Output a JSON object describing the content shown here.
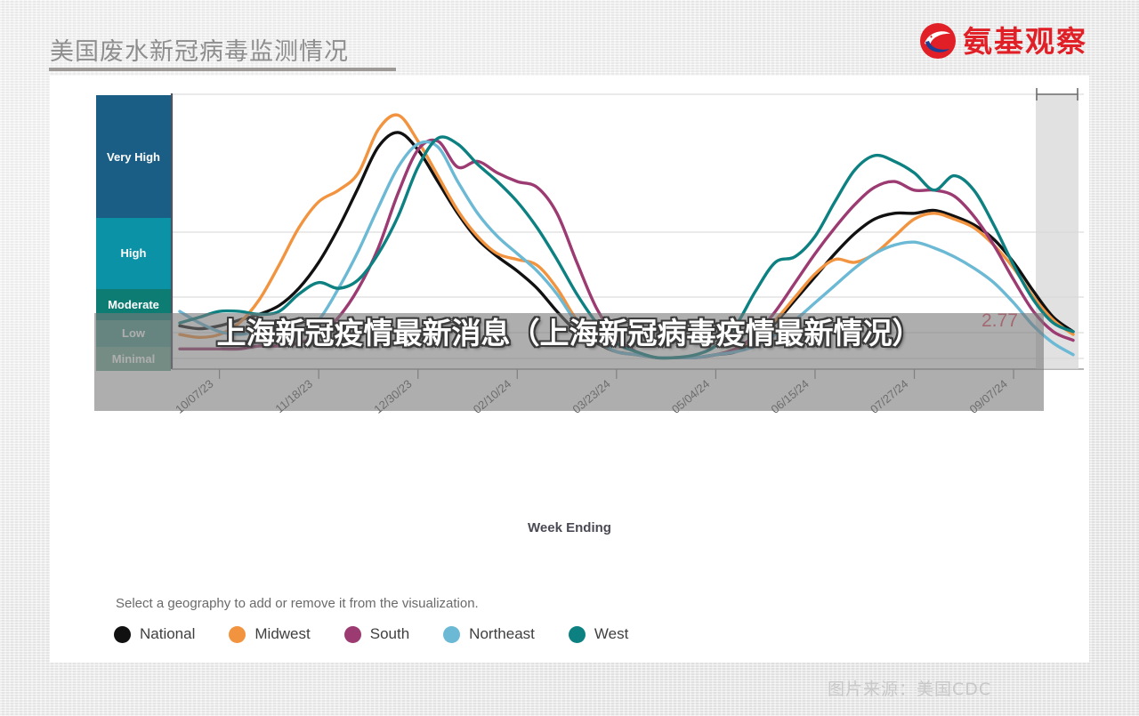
{
  "header": {
    "title": "美国废水新冠病毒监测情况",
    "brand_name": "氨基观察",
    "brand_mark": "circular-swoosh-logo"
  },
  "overlay": {
    "text": "上海新冠疫情最新消息（上海新冠病毒疫情最新情况）"
  },
  "source": {
    "text": "图片来源：美国CDC"
  },
  "legend": {
    "hint": "Select a geography to add or remove it from the visualization.",
    "items": [
      {
        "label": "National",
        "color": "#111111"
      },
      {
        "label": "Midwest",
        "color": "#f2943f"
      },
      {
        "label": "South",
        "color": "#9c3a72"
      },
      {
        "label": "Northeast",
        "color": "#6bb9d4"
      },
      {
        "label": "West",
        "color": "#0d8082"
      }
    ]
  },
  "chart_data": {
    "type": "line",
    "title": "",
    "xlabel": "Week Ending",
    "ylabel": "",
    "grid": true,
    "legend_position": "bottom",
    "value_label": "2.77",
    "provisional_band_label": "provisional-data",
    "y_categories": [
      {
        "label": "Very High",
        "color": "#1b5e85"
      },
      {
        "label": "High",
        "color": "#0b92a6"
      },
      {
        "label": "Moderate",
        "color": "#0d7d74"
      },
      {
        "label": "Low",
        "color": "#4e9a8c"
      },
      {
        "label": "Minimal",
        "color": "#72ab97"
      }
    ],
    "x_tick_labels": [
      "10/07/23",
      "11/18/23",
      "12/30/23",
      "02/10/24",
      "03/23/24",
      "05/04/24",
      "06/15/24",
      "07/27/24",
      "09/07/24"
    ],
    "series": [
      {
        "name": "National",
        "color": "#111111",
        "values": [
          3.1,
          3.0,
          3.1,
          3.3,
          3.5,
          3.8,
          4.4,
          5.3,
          6.5,
          7.9,
          9.3,
          9.8,
          9.2,
          8.1,
          7.0,
          6.1,
          5.5,
          5.0,
          4.4,
          3.6,
          2.9,
          2.5,
          2.2,
          2.1,
          2.0,
          2.0,
          2.0,
          2.1,
          2.2,
          2.6,
          3.2,
          4.0,
          4.8,
          5.6,
          6.3,
          6.8,
          7.0,
          7.0,
          7.1,
          6.9,
          6.6,
          6.1,
          5.3,
          4.3,
          3.4,
          2.9
        ]
      },
      {
        "name": "Midwest",
        "color": "#f2943f",
        "values": [
          2.8,
          2.7,
          2.8,
          3.2,
          4.0,
          5.2,
          6.5,
          7.4,
          7.8,
          8.4,
          9.9,
          10.4,
          9.5,
          8.3,
          7.1,
          6.2,
          5.6,
          5.4,
          5.2,
          4.4,
          3.3,
          2.6,
          2.2,
          2.1,
          2.0,
          2.0,
          2.0,
          2.1,
          2.3,
          2.7,
          3.3,
          4.1,
          4.9,
          5.4,
          5.3,
          5.6,
          6.2,
          6.8,
          7.0,
          6.8,
          6.5,
          5.9,
          5.1,
          4.1,
          3.3,
          2.8
        ]
      },
      {
        "name": "South",
        "color": "#9c3a72",
        "values": [
          2.3,
          2.3,
          2.3,
          2.3,
          2.4,
          2.4,
          2.5,
          2.8,
          3.4,
          4.4,
          5.8,
          7.7,
          9.2,
          9.5,
          8.6,
          8.8,
          8.4,
          8.1,
          7.9,
          7.0,
          5.3,
          3.7,
          2.7,
          2.2,
          2.0,
          2.0,
          2.0,
          2.1,
          2.3,
          2.8,
          3.6,
          4.6,
          5.6,
          6.5,
          7.3,
          7.9,
          8.1,
          7.8,
          7.8,
          7.6,
          6.9,
          5.9,
          4.7,
          3.6,
          2.9,
          2.6
        ]
      },
      {
        "name": "Northeast",
        "color": "#6bb9d4",
        "values": [
          3.6,
          3.2,
          2.9,
          2.8,
          2.9,
          2.9,
          2.8,
          3.3,
          4.4,
          5.7,
          7.2,
          8.6,
          9.4,
          9.3,
          8.1,
          7.0,
          6.2,
          5.6,
          5.0,
          4.2,
          3.2,
          2.6,
          2.2,
          2.1,
          2.0,
          2.0,
          2.0,
          2.1,
          2.2,
          2.4,
          2.8,
          3.3,
          3.9,
          4.5,
          5.1,
          5.6,
          5.9,
          6.0,
          5.8,
          5.5,
          5.1,
          4.6,
          3.9,
          3.1,
          2.5,
          2.1
        ]
      },
      {
        "name": "West",
        "color": "#0d8082",
        "values": [
          3.2,
          3.4,
          3.6,
          3.6,
          3.5,
          3.6,
          4.2,
          4.6,
          4.4,
          4.7,
          5.6,
          6.9,
          8.6,
          9.6,
          9.4,
          8.7,
          8.1,
          7.4,
          6.5,
          5.4,
          4.2,
          3.2,
          2.5,
          2.2,
          2.0,
          2.0,
          2.1,
          2.4,
          3.1,
          4.3,
          5.3,
          5.5,
          6.2,
          7.4,
          8.5,
          9.0,
          8.8,
          8.4,
          7.8,
          8.3,
          7.8,
          6.6,
          5.2,
          4.0,
          3.2,
          2.9
        ]
      }
    ]
  }
}
